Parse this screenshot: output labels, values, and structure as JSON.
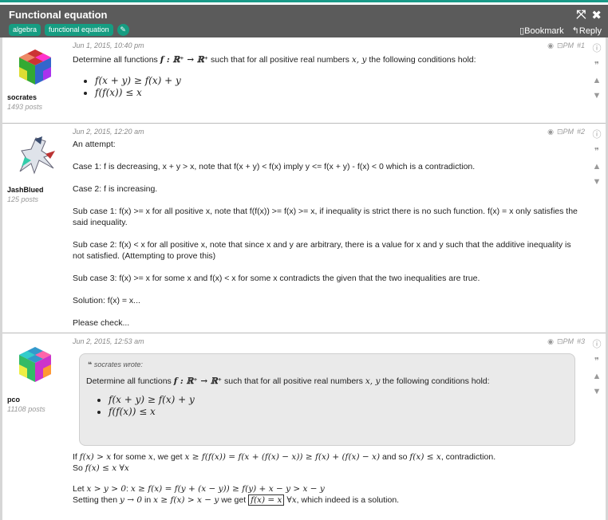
{
  "thread": {
    "title": "Functional equation",
    "tags": [
      "algebra",
      "functional equation"
    ],
    "bookmark_label": "Bookmark",
    "reply_label": "Reply",
    "window_icons": [
      "expand-icon",
      "close-icon"
    ]
  },
  "posts": [
    {
      "author": "socrates",
      "post_count": "1493 posts",
      "date": "Jun 1, 2015, 10:40 pm",
      "number": "#1",
      "pm": "PM",
      "lines": {
        "intro_start": "Determine all functions",
        "intro_math": "f : ℝ⁺ → ℝ⁺",
        "intro_mid": "such that for all positive real numbers",
        "intro_vars": "x, y",
        "intro_end": "the following conditions hold:",
        "cond1": "f(x + y) ≥ f(x) + y",
        "cond2": "f(f(x)) ≤ x"
      }
    },
    {
      "author": "JashBlued",
      "post_count": "125 posts",
      "date": "Jun 2, 2015, 12:20 am",
      "number": "#2",
      "pm": "PM",
      "paragraphs": [
        "An attempt:",
        "Case 1: f is decreasing, x + y > x, note that f(x + y) < f(x) imply y <= f(x + y) - f(x) < 0 which is a contradiction.",
        "Case 2: f is increasing.",
        "Sub case 1: f(x) >= x for all positive x, note that f(f(x)) >= f(x) >= x, if inequality is strict there is no such function. f(x) = x only satisfies the said inequality.",
        "Sub case 2: f(x) < x for all positive x, note that since x and y are arbitrary, there is a value for x and y such that the additive inequality is not satisfied. (Attempting to prove this)",
        "Sub case 3: f(x) >= x for some x and f(x) < x for some x contradicts the given that the two inequalities are true.",
        "Solution: f(x) = x...",
        "Please check..."
      ]
    },
    {
      "author": "pco",
      "post_count": "11108 posts",
      "date": "Jun 2, 2015, 12:53 am",
      "number": "#3",
      "pm": "PM",
      "quote": {
        "header": "socrates wrote:",
        "intro_start": "Determine all functions",
        "intro_math": "f : ℝ⁺ → ℝ⁺",
        "intro_mid": "such that for all positive real numbers",
        "intro_vars": "x, y",
        "intro_end": "the following conditions hold:",
        "cond1": "f(x + y) ≥ f(x) + y",
        "cond2": "f(f(x)) ≤ x"
      },
      "reply": {
        "l1a": "If",
        "l1m1": "f(x) > x",
        "l1b": "for some",
        "l1m2": "x",
        "l1c": ", we get",
        "l1m3": "x ≥ f(f(x)) = f(x + (f(x) − x)) ≥ f(x) + (f(x) − x)",
        "l1d": "and so",
        "l1m4": "f(x) ≤ x",
        "l1e": ", contradiction.",
        "l2a": "So",
        "l2m": "f(x) ≤ x ∀x",
        "l3a": "Let",
        "l3m1": "x > y > 0",
        "l3b": ":",
        "l3m2": "x ≥ f(x) = f(y + (x − y)) ≥ f(y) + x − y > x − y",
        "l4a": "Setting then",
        "l4m1": "y → 0",
        "l4b": "in",
        "l4m2": "x ≥ f(x) > x − y",
        "l4c": "we get",
        "l4m3": "f(x) = x",
        "l4m4": "∀x",
        "l4d": ", which indeed is a solution."
      }
    }
  ]
}
